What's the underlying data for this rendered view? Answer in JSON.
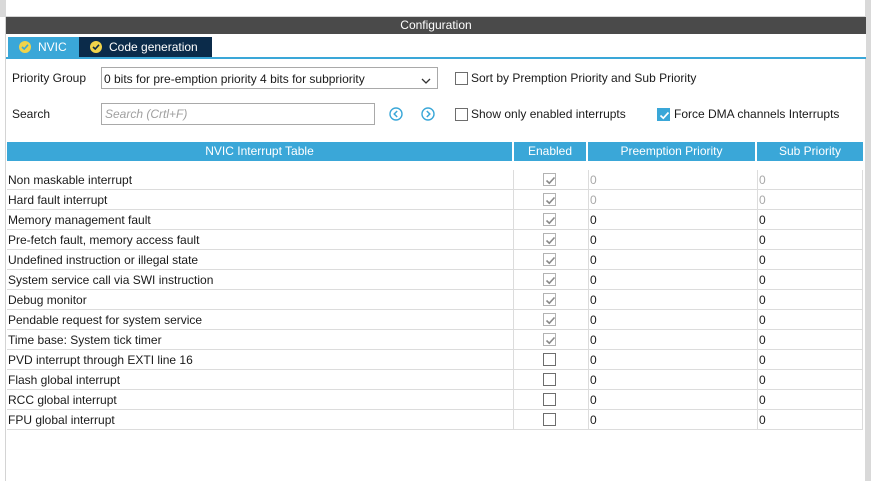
{
  "config_header": "Configuration",
  "tabs": [
    {
      "label": "NVIC",
      "icon": "check-badge-icon",
      "active": true
    },
    {
      "label": "Code generation",
      "icon": "check-badge-icon",
      "active": false
    }
  ],
  "priority_group": {
    "label": "Priority Group",
    "value": "0 bits for pre-emption priority 4 bits for subpriority"
  },
  "search": {
    "label": "Search",
    "placeholder": "Search (Crtl+F)"
  },
  "options": {
    "sort_label": "Sort by Premption Priority and Sub Priority",
    "sort_checked": false,
    "show_enabled_label": "Show only enabled interrupts",
    "show_enabled_checked": false,
    "force_dma_label": "Force DMA channels Interrupts",
    "force_dma_checked": true
  },
  "table": {
    "headers": [
      "NVIC Interrupt Table",
      "Enabled",
      "Preemption Priority",
      "Sub Priority"
    ],
    "rows": [
      {
        "name": "Non maskable interrupt",
        "enabled": true,
        "locked": true,
        "preemption": "0",
        "sub": "0",
        "muted": true
      },
      {
        "name": "Hard fault interrupt",
        "enabled": true,
        "locked": true,
        "preemption": "0",
        "sub": "0",
        "muted": true
      },
      {
        "name": "Memory management fault",
        "enabled": true,
        "locked": true,
        "preemption": "0",
        "sub": "0",
        "muted": false
      },
      {
        "name": "Pre-fetch fault, memory access fault",
        "enabled": true,
        "locked": true,
        "preemption": "0",
        "sub": "0",
        "muted": false
      },
      {
        "name": "Undefined instruction or illegal state",
        "enabled": true,
        "locked": true,
        "preemption": "0",
        "sub": "0",
        "muted": false
      },
      {
        "name": "System service call via SWI instruction",
        "enabled": true,
        "locked": true,
        "preemption": "0",
        "sub": "0",
        "muted": false
      },
      {
        "name": "Debug monitor",
        "enabled": true,
        "locked": true,
        "preemption": "0",
        "sub": "0",
        "muted": false
      },
      {
        "name": "Pendable request for system service",
        "enabled": true,
        "locked": true,
        "preemption": "0",
        "sub": "0",
        "muted": false
      },
      {
        "name": "Time base: System tick timer",
        "enabled": true,
        "locked": true,
        "preemption": "0",
        "sub": "0",
        "muted": false
      },
      {
        "name": "PVD interrupt through EXTI line 16",
        "enabled": false,
        "locked": false,
        "preemption": "0",
        "sub": "0",
        "muted": false
      },
      {
        "name": "Flash global interrupt",
        "enabled": false,
        "locked": false,
        "preemption": "0",
        "sub": "0",
        "muted": false
      },
      {
        "name": "RCC global interrupt",
        "enabled": false,
        "locked": false,
        "preemption": "0",
        "sub": "0",
        "muted": false
      },
      {
        "name": "FPU global interrupt",
        "enabled": false,
        "locked": false,
        "preemption": "0",
        "sub": "0",
        "muted": false
      }
    ]
  },
  "colors": {
    "accent": "#3aa7d8",
    "header_dark": "#4a4a4a",
    "tab_dark": "#0b2b4a",
    "tab_icon": "#f0d34a"
  }
}
